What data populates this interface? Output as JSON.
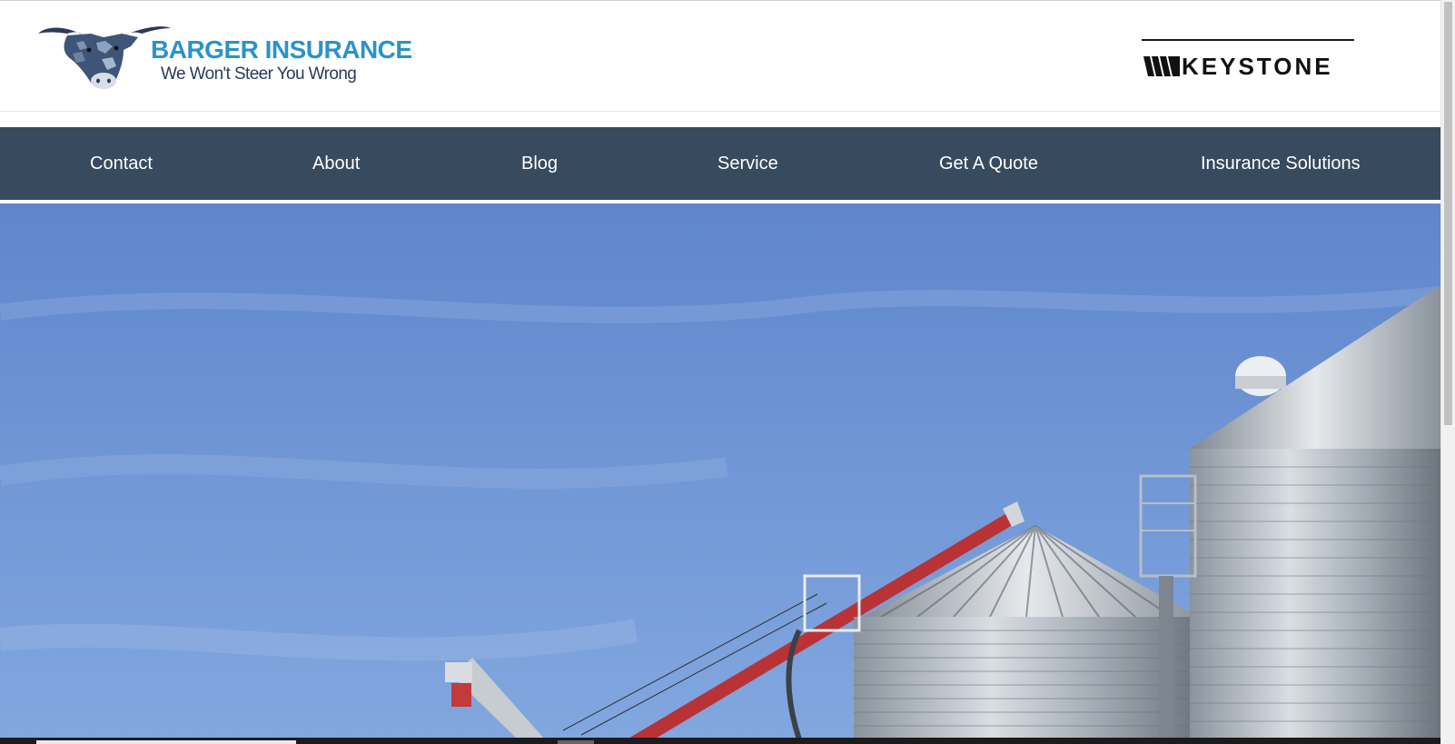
{
  "header": {
    "brand_name": "BARGER INSURANCE",
    "brand_tagline": "We Won't Steer You Wrong",
    "partner_logo_text": "KEYSTONE"
  },
  "nav": {
    "items": [
      {
        "label": "Contact"
      },
      {
        "label": "About"
      },
      {
        "label": "Blog"
      },
      {
        "label": "Service"
      },
      {
        "label": "Get A Quote"
      },
      {
        "label": "Insurance Solutions"
      }
    ]
  },
  "hero": {
    "icon": "hero-grain-bins-image"
  },
  "colors": {
    "nav_background": "#374a5e",
    "brand_blue": "#2a93c9",
    "brand_navy": "#2b3b57",
    "sky": "#6f98d6"
  }
}
